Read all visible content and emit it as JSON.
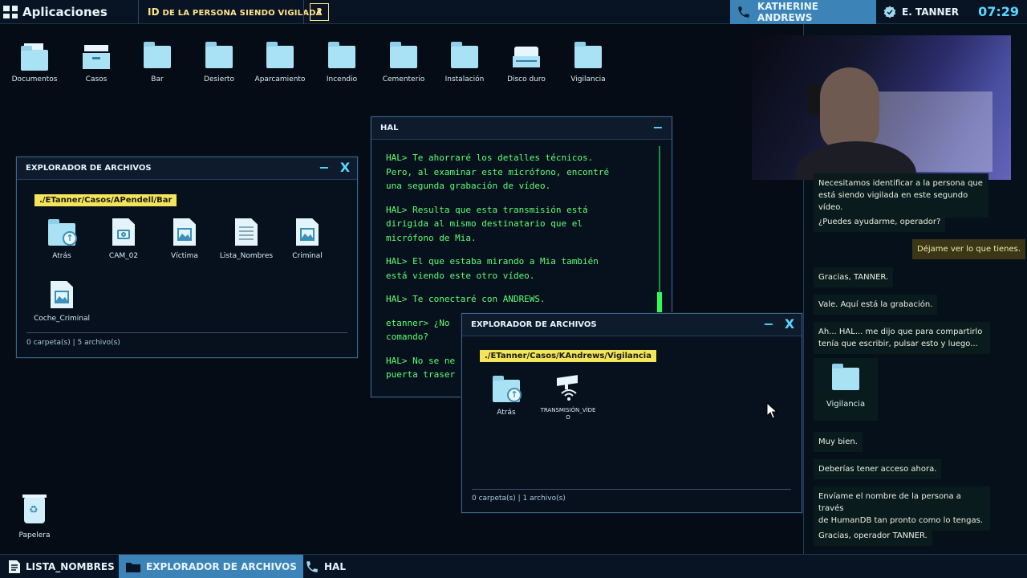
{
  "topbar": {
    "apps_label": "Aplicaciones",
    "task_prefix": "ID",
    "task_text": "DE LA PERSONA SIENDO VIGILADA",
    "help_label": "?",
    "call_name": "KATHERINE ANDREWS",
    "user_name": "E. TANNER",
    "clock": "07:29"
  },
  "desktop_icons": [
    {
      "label": "Documentos",
      "icon": "documents-folder-icon"
    },
    {
      "label": "Casos",
      "icon": "cases-drawer-icon"
    },
    {
      "label": "Bar",
      "icon": "folder-icon"
    },
    {
      "label": "Desierto",
      "icon": "folder-icon"
    },
    {
      "label": "Aparcamiento",
      "icon": "folder-icon"
    },
    {
      "label": "Incendio",
      "icon": "folder-icon"
    },
    {
      "label": "Cementerio",
      "icon": "folder-icon"
    },
    {
      "label": "Instalación",
      "icon": "folder-icon"
    },
    {
      "label": "Disco duro",
      "icon": "hard-drive-icon"
    },
    {
      "label": "Vigilancia",
      "icon": "folder-icon"
    }
  ],
  "explorer1": {
    "title": "EXPLORADOR DE ARCHIVOS",
    "minimize": "−",
    "close": "X",
    "path": "./ETanner/Casos/APendell/Bar",
    "files": [
      {
        "label": "Atrás",
        "icon": "back-folder-icon"
      },
      {
        "label": "CAM_02",
        "icon": "camera-file-icon"
      },
      {
        "label": "Víctima",
        "icon": "image-file-icon"
      },
      {
        "label": "Lista_Nombres",
        "icon": "text-file-icon"
      },
      {
        "label": "Criminal",
        "icon": "image-file-icon"
      },
      {
        "label": "Coche_Criminal",
        "icon": "image-file-icon"
      }
    ],
    "status": "0 carpeta(s) | 5 archivo(s)"
  },
  "hal": {
    "title": "HAL",
    "minimize": "−",
    "lines": [
      "HAL> Te ahorraré los detalles técnicos.\nPero, al examinar este micrófono, encontré\nuna segunda grabación de vídeo.",
      "HAL> Resulta que esta transmisión está\ndirigida al mismo destinatario que el\nmicrófono de Mia.",
      "HAL> El que estaba mirando a Mia también\nestá viendo este otro vídeo.",
      "HAL> Te conectaré con ANDREWS.",
      "etanner> ¿No\ncomando?",
      "HAL> No se ne\npuerta traser"
    ]
  },
  "explorer2": {
    "title": "EXPLORADOR DE ARCHIVOS",
    "minimize": "−",
    "close": "X",
    "path": "./ETanner/Casos/KAndrews/Vigilancia",
    "files": [
      {
        "label": "Atrás",
        "icon": "back-folder-icon"
      },
      {
        "label_line1": "TRANSMISIÓN_VÍDE",
        "label_line2": "O",
        "icon": "camera-stream-icon"
      }
    ],
    "status": "0 carpeta(s) | 1 archivo(s)"
  },
  "chat": {
    "messages": [
      {
        "from": "other",
        "text": "Necesitamos identificar a la persona que\nestá siendo vigilada en este segundo vídeo."
      },
      {
        "from": "other",
        "text": "¿Puedes ayudarme, operador?"
      },
      {
        "from": "me",
        "text": "Déjame ver lo que tienes."
      },
      {
        "from": "other",
        "text": "Gracias, TANNER."
      },
      {
        "from": "other",
        "text": "Vale. Aquí está la grabación."
      },
      {
        "from": "other",
        "text": "Ah... HAL... me dijo que para compartirlo\ntenía que escribir, pulsar esto y luego..."
      },
      {
        "from": "other",
        "text": "Muy bien."
      },
      {
        "from": "other",
        "text": "Deberías tener acceso ahora."
      },
      {
        "from": "other",
        "text": "Envíame el nombre de la persona a través\nde HumanDB tan pronto como lo tengas."
      },
      {
        "from": "other",
        "text": "Gracias, operador TANNER."
      }
    ],
    "shared_folder_label": "Vigilancia"
  },
  "desktop": {
    "trash_label": "Papelera"
  },
  "taskbar": [
    {
      "label": "LISTA_NOMBRES",
      "icon": "document-icon",
      "active": false
    },
    {
      "label": "EXPLORADOR DE ARCHIVOS",
      "icon": "folder-icon",
      "active": true
    },
    {
      "label": "HAL",
      "icon": "phone-icon",
      "active": false
    }
  ],
  "colors": {
    "accent": "#59d8ff",
    "terminal_green": "#5dff72",
    "path_yellow": "#f3e45a",
    "call_blue": "#3c84b8"
  }
}
